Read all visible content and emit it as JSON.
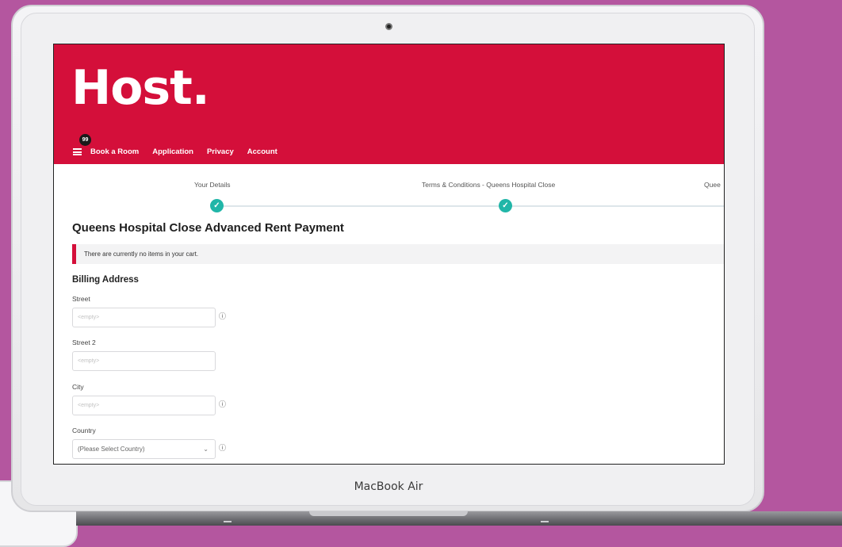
{
  "device": {
    "label": "MacBook Air"
  },
  "site": {
    "logo": "Host.",
    "cart_badge": "99",
    "nav": [
      "Book a Room",
      "Application",
      "Privacy",
      "Account"
    ]
  },
  "steps": [
    {
      "label": "Your Details",
      "complete": true
    },
    {
      "label": "Terms & Conditions - Queens Hospital Close",
      "complete": true
    },
    {
      "label": "Quee",
      "complete": false
    }
  ],
  "page": {
    "title": "Queens Hospital Close Advanced Rent Payment",
    "notice": "There are currently no items in your cart."
  },
  "billing": {
    "heading": "Billing Address",
    "street": {
      "label": "Street",
      "placeholder": "<empty>"
    },
    "street2": {
      "label": "Street 2",
      "placeholder": "<empty>"
    },
    "city": {
      "label": "City",
      "placeholder": "<empty>"
    },
    "country": {
      "label": "Country",
      "value": "(Please Select Country)"
    }
  },
  "colors": {
    "brand_red": "#d40f3a",
    "step_teal": "#21b6a8",
    "background": "#b4569f"
  }
}
